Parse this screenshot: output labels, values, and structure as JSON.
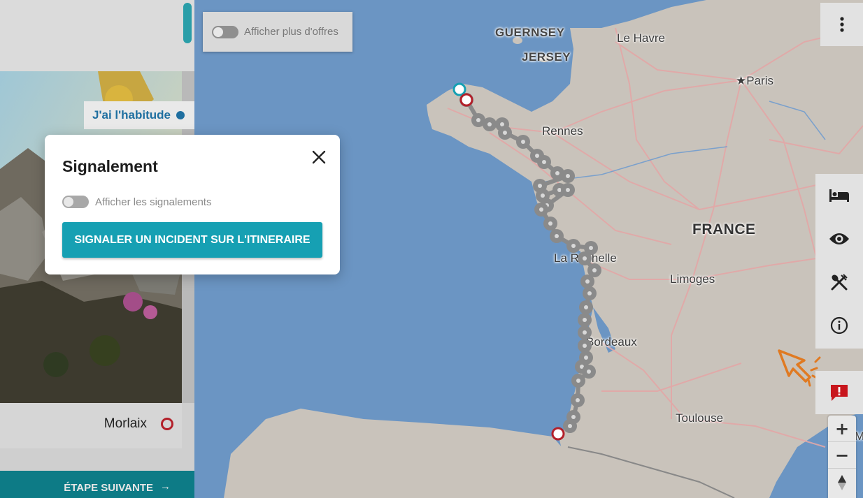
{
  "map": {
    "labels": {
      "guernsey": "GUERNSEY",
      "jersey": "JERSEY",
      "le_havre": "Le Havre",
      "paris": "Paris",
      "rennes": "Rennes",
      "france": "FRANCE",
      "la_rochelle": "La Rochelle",
      "limoges": "Limoges",
      "bordeaux": "Bordeaux",
      "toulouse": "Toulouse",
      "marseille_partial": "Ma"
    },
    "colors": {
      "sea": "#6b95c3",
      "land": "#c9c3bb",
      "roads": "#e2a6a6",
      "route": "#8a8a8a",
      "start_marker": "#16a0b3",
      "end_marker": "#b3202a"
    }
  },
  "left_panel": {
    "badge": "J'ai l'habitude",
    "stop_name": "Morlaix",
    "next_step": "ÉTAPE SUIVANTE"
  },
  "offers_toggle": {
    "label": "Afficher plus d'offres",
    "on": false
  },
  "toolbar": {
    "more_icon": "dots-vertical-icon",
    "items": [
      "bed-icon",
      "eye-icon",
      "fork-knife-icon",
      "info-icon"
    ],
    "report_icon": "report-alert-icon",
    "zoom_in": "+",
    "zoom_out": "−"
  },
  "modal": {
    "title": "Signalement",
    "toggle_label": "Afficher les signalements",
    "toggle_on": false,
    "cta": "SIGNALER UN INCIDENT SUR L'ITINERAIRE"
  }
}
